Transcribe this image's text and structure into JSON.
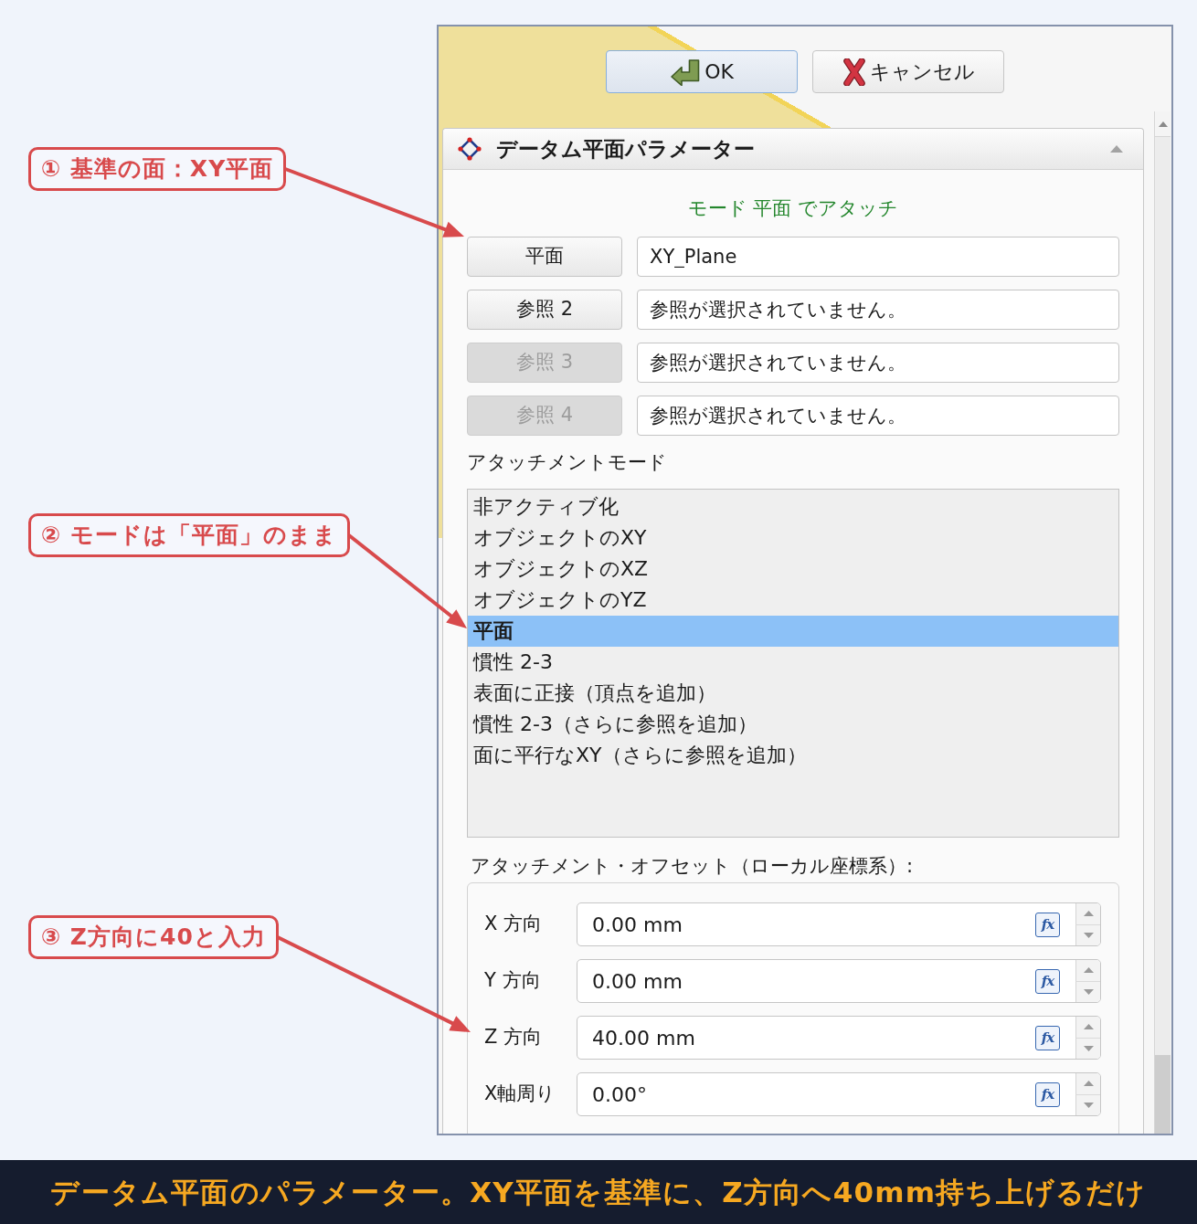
{
  "callouts": [
    "① 基準の面：XY平面",
    "② モードは「平面」のまま",
    "③ Z方向に40と入力"
  ],
  "dialog": {
    "buttons": [
      {
        "kind": "ok",
        "label": "OK"
      },
      {
        "kind": "cancel",
        "label": "キャンセル"
      }
    ]
  },
  "panel": {
    "title": "データム平面パラメーター",
    "expanded": true,
    "mode_message": "モード 平面 でアタッチ",
    "references": [
      {
        "button": "平面",
        "disabled": false,
        "value": "XY_Plane"
      },
      {
        "button": "参照 2",
        "disabled": false,
        "value": "参照が選択されていません。"
      },
      {
        "button": "参照 3",
        "disabled": true,
        "value": "参照が選択されていません。"
      },
      {
        "button": "参照 4",
        "disabled": true,
        "value": "参照が選択されていません。"
      }
    ],
    "attachment_mode": {
      "label": "アタッチメントモード",
      "items": [
        {
          "label": "非アクティブ化",
          "selected": false
        },
        {
          "label": "オブジェクトのXY",
          "selected": false
        },
        {
          "label": "オブジェクトのXZ",
          "selected": false
        },
        {
          "label": "オブジェクトのYZ",
          "selected": false
        },
        {
          "label": "平面",
          "selected": true
        },
        {
          "label": "慣性 2-3",
          "selected": false
        },
        {
          "label": "表面に正接（頂点を追加）",
          "selected": false
        },
        {
          "label": "慣性 2-3（さらに参照を追加）",
          "selected": false
        },
        {
          "label": "面に平行なXY（さらに参照を追加）",
          "selected": false
        }
      ]
    },
    "offset": {
      "label": "アタッチメント・オフセット（ローカル座標系）:",
      "rows": [
        {
          "label": "X 方向",
          "value": "0.00 mm",
          "formula": "fx"
        },
        {
          "label": "Y 方向",
          "value": "0.00 mm",
          "formula": "fx"
        },
        {
          "label": "Z 方向",
          "value": "40.00 mm",
          "formula": "fx"
        },
        {
          "label": "X軸周り",
          "value": "0.00°",
          "formula": "fx"
        }
      ]
    }
  },
  "caption": "データム平面のパラメーター。XY平面を基準に、Z方向へ40mm持ち上げるだけ"
}
